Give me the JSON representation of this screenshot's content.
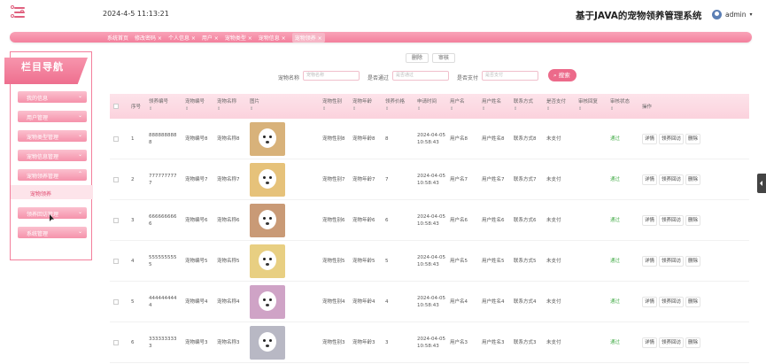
{
  "header": {
    "datetime": "2024-4-5 11:13:21",
    "site_title": "基于JAVA的宠物领养管理系统",
    "user_name": "admin",
    "caret": "▾"
  },
  "tabs": [
    {
      "label": "系统首页",
      "active": false
    },
    {
      "label": "修改密码 ×",
      "active": false
    },
    {
      "label": "个人信息 ×",
      "active": false
    },
    {
      "label": "用户 ×",
      "active": false
    },
    {
      "label": "宠物类型 ×",
      "active": false
    },
    {
      "label": "宠物信息 ×",
      "active": false
    },
    {
      "label": "宠物领养 ×",
      "active": true
    }
  ],
  "sidebar": {
    "title": "栏目导航",
    "items": [
      {
        "label": "我的信息",
        "chevron": "⌄"
      },
      {
        "label": "用户管理",
        "chevron": "⌄"
      },
      {
        "label": "宠物类型管理",
        "chevron": "⌄"
      },
      {
        "label": "宠物信息管理",
        "chevron": "⌄"
      },
      {
        "label": "宠物领养管理",
        "chevron": "⌃"
      },
      {
        "label": "领养回访管理",
        "chevron": "⌄"
      },
      {
        "label": "系统管理",
        "chevron": "⌄"
      }
    ],
    "sub_item": "宠物领养"
  },
  "actions": {
    "delete": "删除",
    "audit": "审核"
  },
  "search": {
    "pet_name_label": "宠物名称",
    "pet_name_placeholder": "宠物名称",
    "passed_label": "是否通过",
    "passed_placeholder": "是否通过",
    "paid_label": "是否支付",
    "paid_placeholder": "是否支付",
    "button": "搜索"
  },
  "table": {
    "headers": {
      "index": "序号",
      "order_no": "领养编号",
      "pet_no": "宠物编号",
      "pet_name": "宠物名称",
      "image": "图片",
      "pet_type": "宠物性别",
      "pet_age": "宠物年龄",
      "fee": "领养价格",
      "apply_time": "申请时间",
      "account": "用户名",
      "user_name": "用户姓名",
      "phone": "联系方式",
      "paid": "是否支付",
      "reply": "审核回复",
      "status": "审核状态",
      "ops": "操作"
    },
    "sort_mark": "⇕",
    "rows": [
      {
        "index": "1",
        "order_no": "888888888 8",
        "pet_no": "宠物编号8",
        "pet_name": "宠物名称8",
        "pet_type": "宠物性别8",
        "pet_age": "宠物年龄8",
        "fee": "8",
        "apply_time": "2024-04-05 10:58:43",
        "account": "用户名8",
        "user_name": "用户姓名8",
        "phone": "联系方式8",
        "paid": "未支付",
        "reply": "",
        "status": "通过",
        "img_bg": "#d8b27a"
      },
      {
        "index": "2",
        "order_no": "777777777 7",
        "pet_no": "宠物编号7",
        "pet_name": "宠物名称7",
        "pet_type": "宠物性别7",
        "pet_age": "宠物年龄7",
        "fee": "7",
        "apply_time": "2024-04-05 10:58:43",
        "account": "用户名7",
        "user_name": "用户姓名7",
        "phone": "联系方式7",
        "paid": "未支付",
        "reply": "",
        "status": "通过",
        "img_bg": "#e6c27a"
      },
      {
        "index": "3",
        "order_no": "666666666 6",
        "pet_no": "宠物编号6",
        "pet_name": "宠物名称6",
        "pet_type": "宠物性别6",
        "pet_age": "宠物年龄6",
        "fee": "6",
        "apply_time": "2024-04-05 10:58:43",
        "account": "用户名6",
        "user_name": "用户姓名6",
        "phone": "联系方式6",
        "paid": "未支付",
        "reply": "",
        "status": "通过",
        "img_bg": "#c99a76"
      },
      {
        "index": "4",
        "order_no": "555555555 5",
        "pet_no": "宠物编号5",
        "pet_name": "宠物名称5",
        "pet_type": "宠物性别5",
        "pet_age": "宠物年龄5",
        "fee": "5",
        "apply_time": "2024-04-05 10:58:43",
        "account": "用户名5",
        "user_name": "用户姓名5",
        "phone": "联系方式5",
        "paid": "未支付",
        "reply": "",
        "status": "通过",
        "img_bg": "#e8cf82"
      },
      {
        "index": "5",
        "order_no": "444444444 4",
        "pet_no": "宠物编号4",
        "pet_name": "宠物名称4",
        "pet_type": "宠物性别4",
        "pet_age": "宠物年龄4",
        "fee": "4",
        "apply_time": "2024-04-05 10:58:43",
        "account": "用户名4",
        "user_name": "用户姓名4",
        "phone": "联系方式4",
        "paid": "未支付",
        "reply": "",
        "status": "通过",
        "img_bg": "#cfa3c6"
      },
      {
        "index": "6",
        "order_no": "333333333 3",
        "pet_no": "宠物编号3",
        "pet_name": "宠物名称3",
        "pet_type": "宠物性别3",
        "pet_age": "宠物年龄3",
        "fee": "3",
        "apply_time": "2024-04-05 10:58:43",
        "account": "用户名3",
        "user_name": "用户姓名3",
        "phone": "联系方式3",
        "paid": "未支付",
        "reply": "",
        "status": "通过",
        "img_bg": "#b8b8c4"
      }
    ],
    "row_ops": [
      "详情",
      "领养回访",
      "删除"
    ]
  },
  "colors": {
    "accent": "#ec6a8a",
    "accent_light": "#fde3ea",
    "passed": "#4caf50"
  }
}
